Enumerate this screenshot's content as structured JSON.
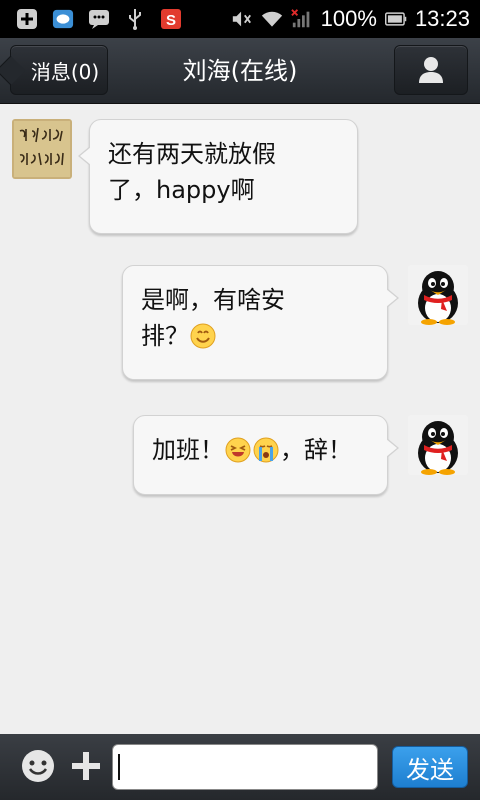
{
  "status_bar": {
    "battery_percent": "100%",
    "time": "13:23",
    "left_icons": [
      "add-notification-icon",
      "chat-app-icon",
      "message-icon",
      "usb-icon",
      "sogou-icon"
    ],
    "right_icons": [
      "mute-icon",
      "wifi-icon",
      "signal-icon",
      "battery-icon"
    ]
  },
  "header": {
    "back_label": "消息(0)",
    "title": "刘海(在线)",
    "profile_icon": "person-icon"
  },
  "messages": [
    {
      "side": "left",
      "avatar": "calligraphy-avatar",
      "lines": [
        "还有两天就放假",
        "了，happy啊"
      ]
    },
    {
      "side": "right",
      "avatar": "penguin-avatar",
      "line1": "是啊，有啥安",
      "line2": "排？",
      "emoji": "smile-emoji"
    },
    {
      "side": "right",
      "avatar": "penguin-avatar",
      "prefix": "加班！",
      "emojis": [
        "laughing-emoji",
        "crying-emoji"
      ],
      "suffix": "，辞！"
    }
  ],
  "input_bar": {
    "message_value": "",
    "send_label": "发送",
    "emoji_icon": "smiley-face-icon",
    "plus_icon": "plus-icon"
  },
  "colors": {
    "title_bar": "#2c3036",
    "chat_background": "#efefef",
    "bubble": "#f7f7f7",
    "send_button": "#2b8fe0"
  }
}
